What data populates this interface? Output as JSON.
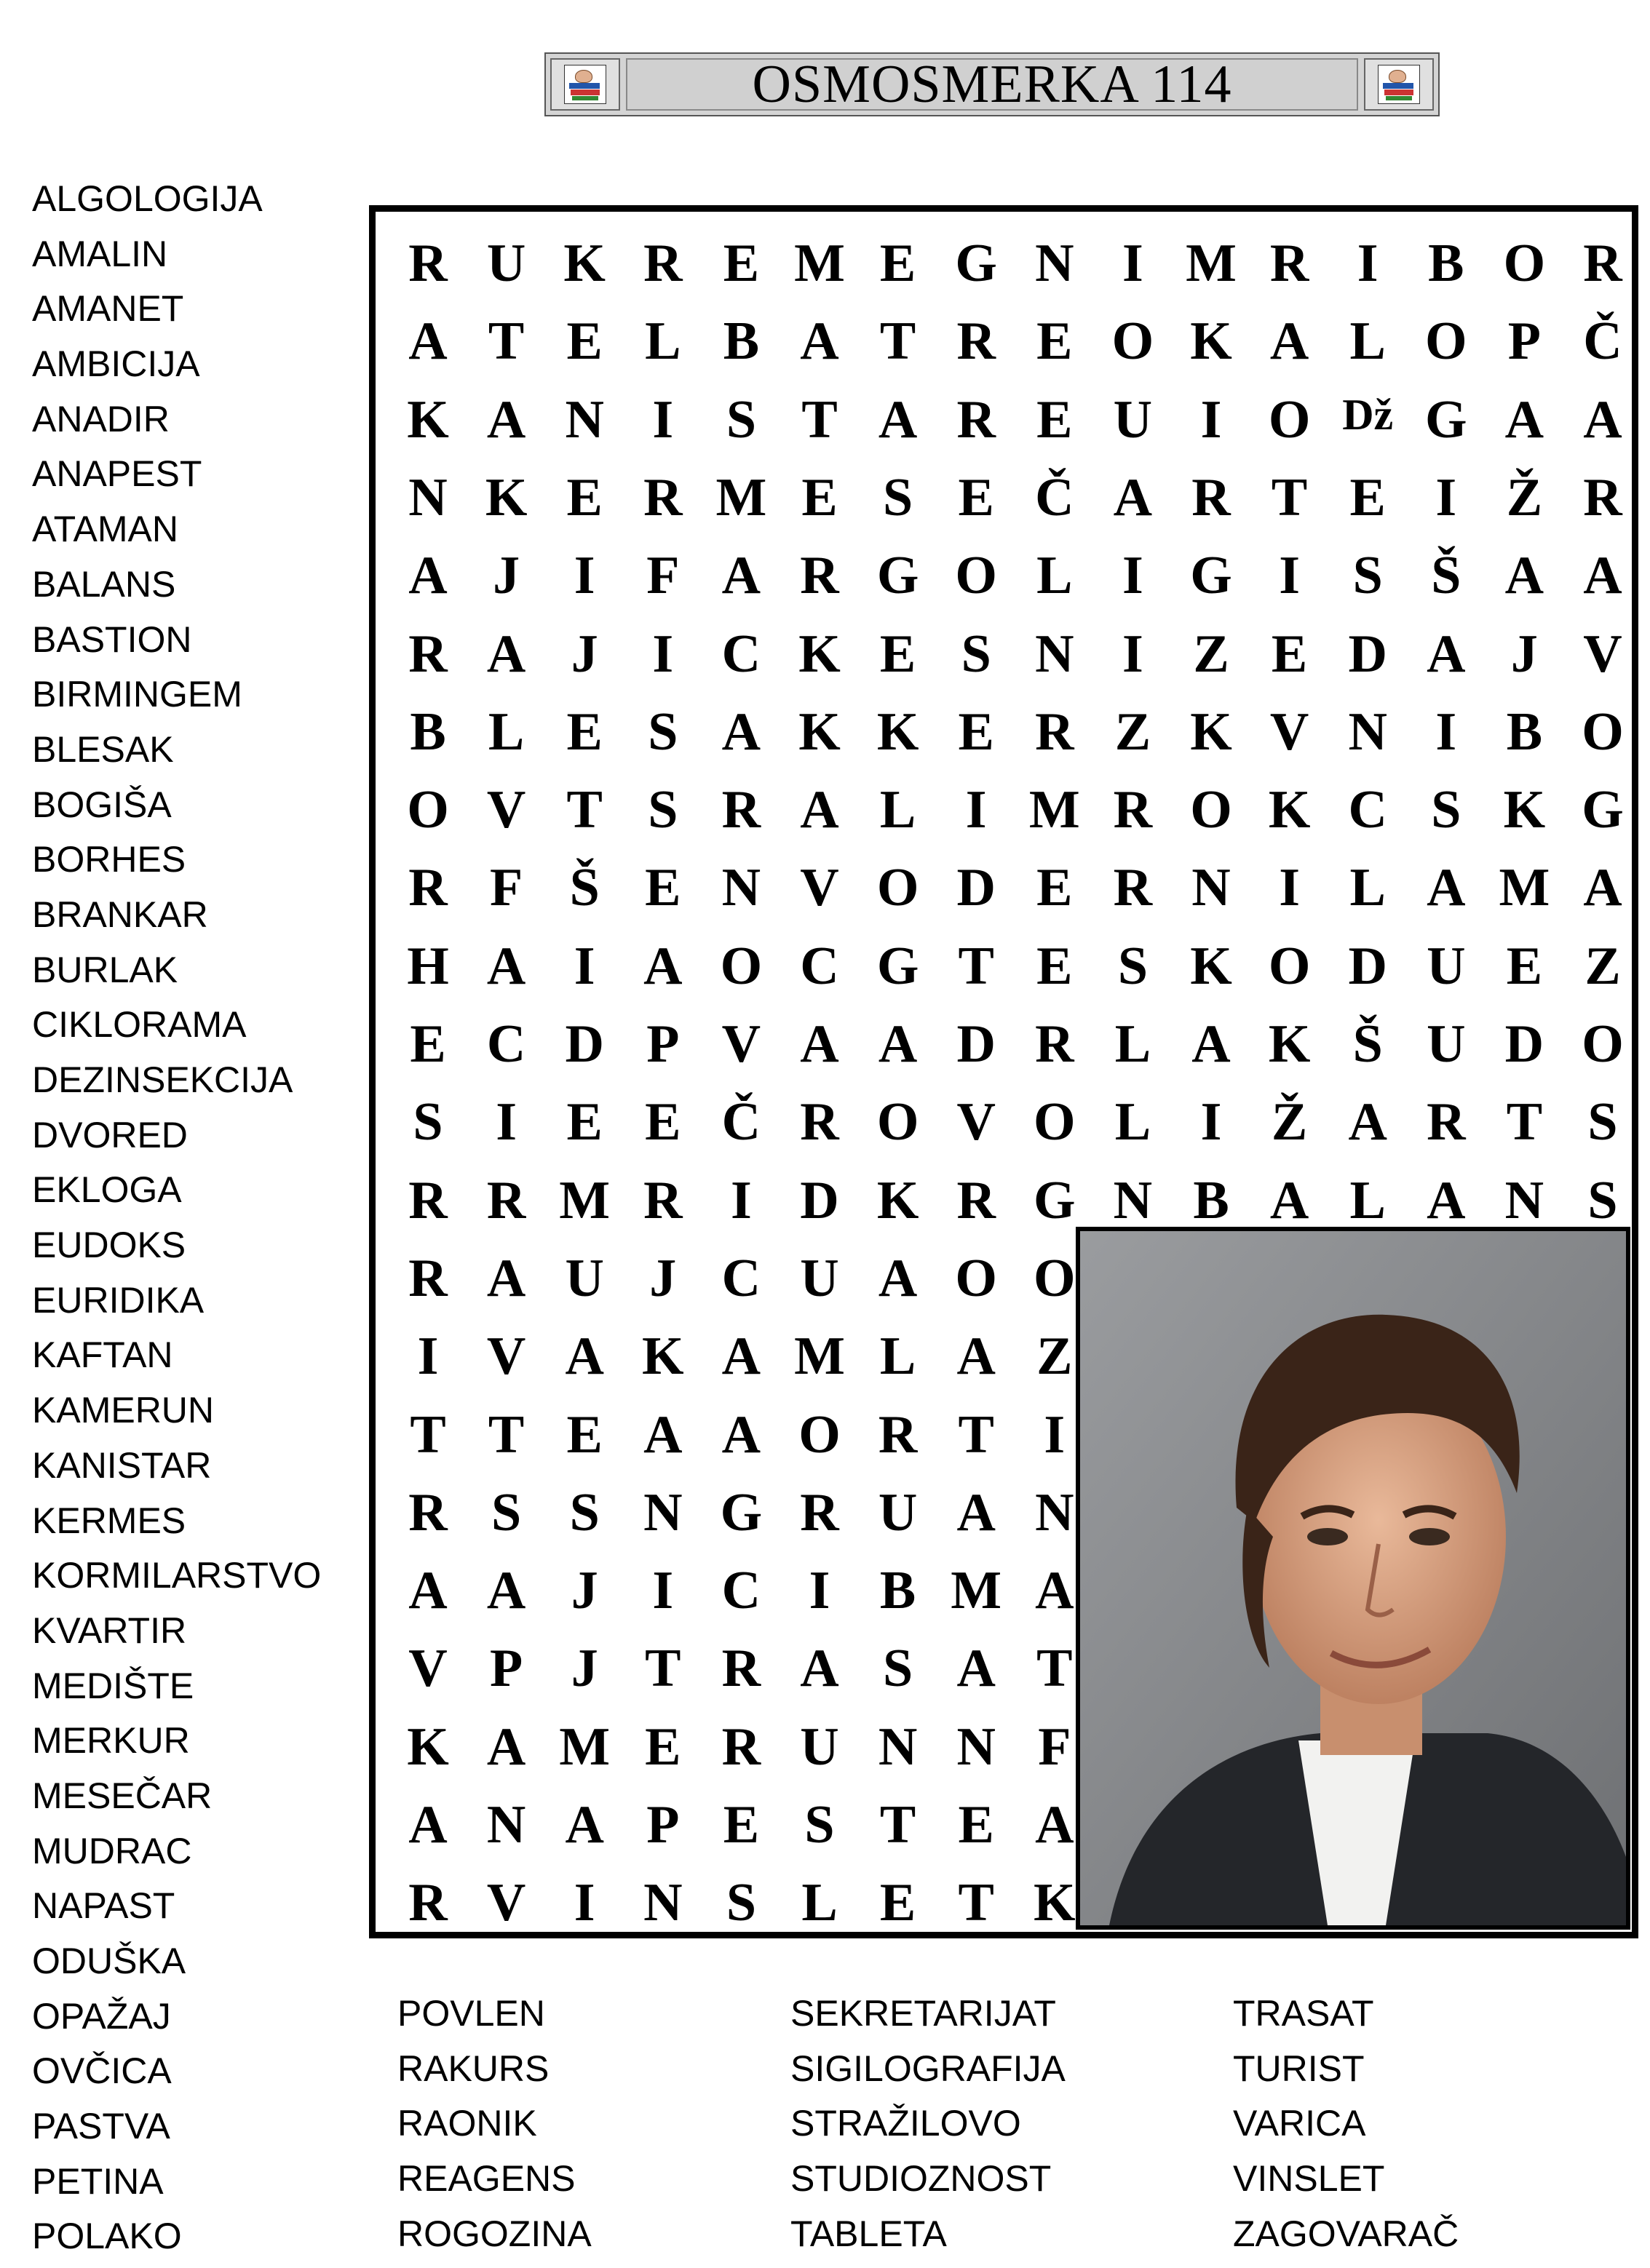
{
  "title": "OSMOSMERKA 114",
  "grid_rows": [
    "RUKREMEGNIMRIBOR",
    "ATELBATREOKALOPČ",
    [
      "K",
      "A",
      "N",
      "I",
      "S",
      "T",
      "A",
      "R",
      "E",
      "U",
      "I",
      "O",
      "Dž",
      "G",
      "A",
      "A"
    ],
    "NKERMESEČARTEIŽR",
    "AJIFARGOLIGISŠAA",
    "RAJICKESNIZEDAJV",
    "BLESAKKERZKVNIBO",
    "OVTSRALIMROKCSKG",
    "RFŠENVODERNILAMA",
    "HAIAOCGTESKODUEZ",
    "ECDPVAADRLAKŠUDO",
    "SIEEČROVOLIŽARTS",
    "RRMRIDKRGNBALANS",
    "RAUJCUAOO",
    "IVAKAMLAZ",
    "TTEAAORTI",
    "RSSNGRUAN",
    "AAJICIBMA",
    "VPJTRASAT",
    "KAMERUNNF",
    "ANAPESTEA",
    "RVINSLETK"
  ],
  "word_list_left": [
    "ALGOLOGIJA",
    "AMALIN",
    "AMANET",
    "AMBICIJA",
    "ANADIR",
    "ANAPEST",
    "ATAMAN",
    "BALANS",
    "BASTION",
    "BIRMINGEM",
    "BLESAK",
    "BOGIŠA",
    "BORHES",
    "BRANKAR",
    "BURLAK",
    "CIKLORAMA",
    "DEZINSEKCIJA",
    "DVORED",
    "EKLOGA",
    "EUDOKS",
    "EURIDIKA",
    "KAFTAN",
    "KAMERUN",
    "KANISTAR",
    "KERMES",
    "KORMILARSTVO",
    "KVARTIR",
    "MEDIŠTE",
    "MERKUR",
    "MESEČAR",
    "MUDRAC",
    "NAPAST",
    "ODUŠKA",
    "OPAŽAJ",
    "OVČICA",
    "PASTVA",
    "PETINA",
    "POLAKO"
  ],
  "word_list_bottom": [
    [
      "POVLEN",
      "RAKURS",
      "RAONIK",
      "REAGENS",
      "ROGOZINA"
    ],
    [
      "SEKRETARIJAT",
      "SIGILOGRAFIJA",
      "STRAŽILOVO",
      "STUDIOZNOST",
      "TABLETA"
    ],
    [
      "TRASAT",
      "TURIST",
      "VARICA",
      "VINSLET",
      "ZAGOVARAČ"
    ]
  ],
  "icons": [
    "books-reader-icon",
    "books-reader-icon"
  ],
  "photo_subject": "portrait-photo"
}
